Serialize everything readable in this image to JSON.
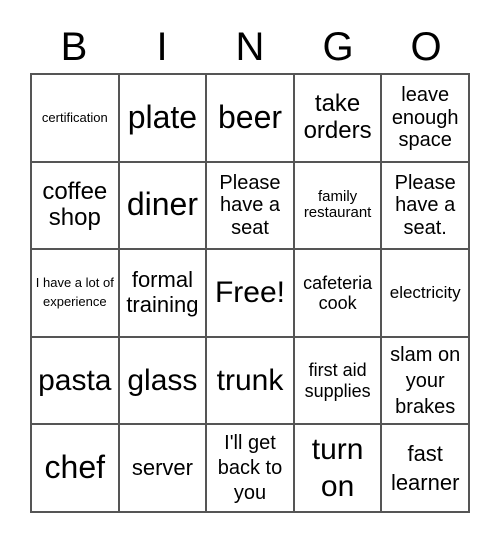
{
  "header": [
    "B",
    "I",
    "N",
    "G",
    "O"
  ],
  "cells": [
    "certification",
    "plate",
    "beer",
    "take orders",
    "leave enough space",
    "coffee shop",
    "diner",
    "Please have a seat",
    "family restaurant",
    "Please have a seat.",
    "I have a lot of experience",
    "formal training",
    "Free!",
    "cafeteria cook",
    "electricity",
    "pasta",
    "glass",
    "trunk",
    "first aid supplies",
    "slam on your brakes",
    "chef",
    "server",
    "I'll get back to you",
    "turn on",
    "fast learner"
  ]
}
